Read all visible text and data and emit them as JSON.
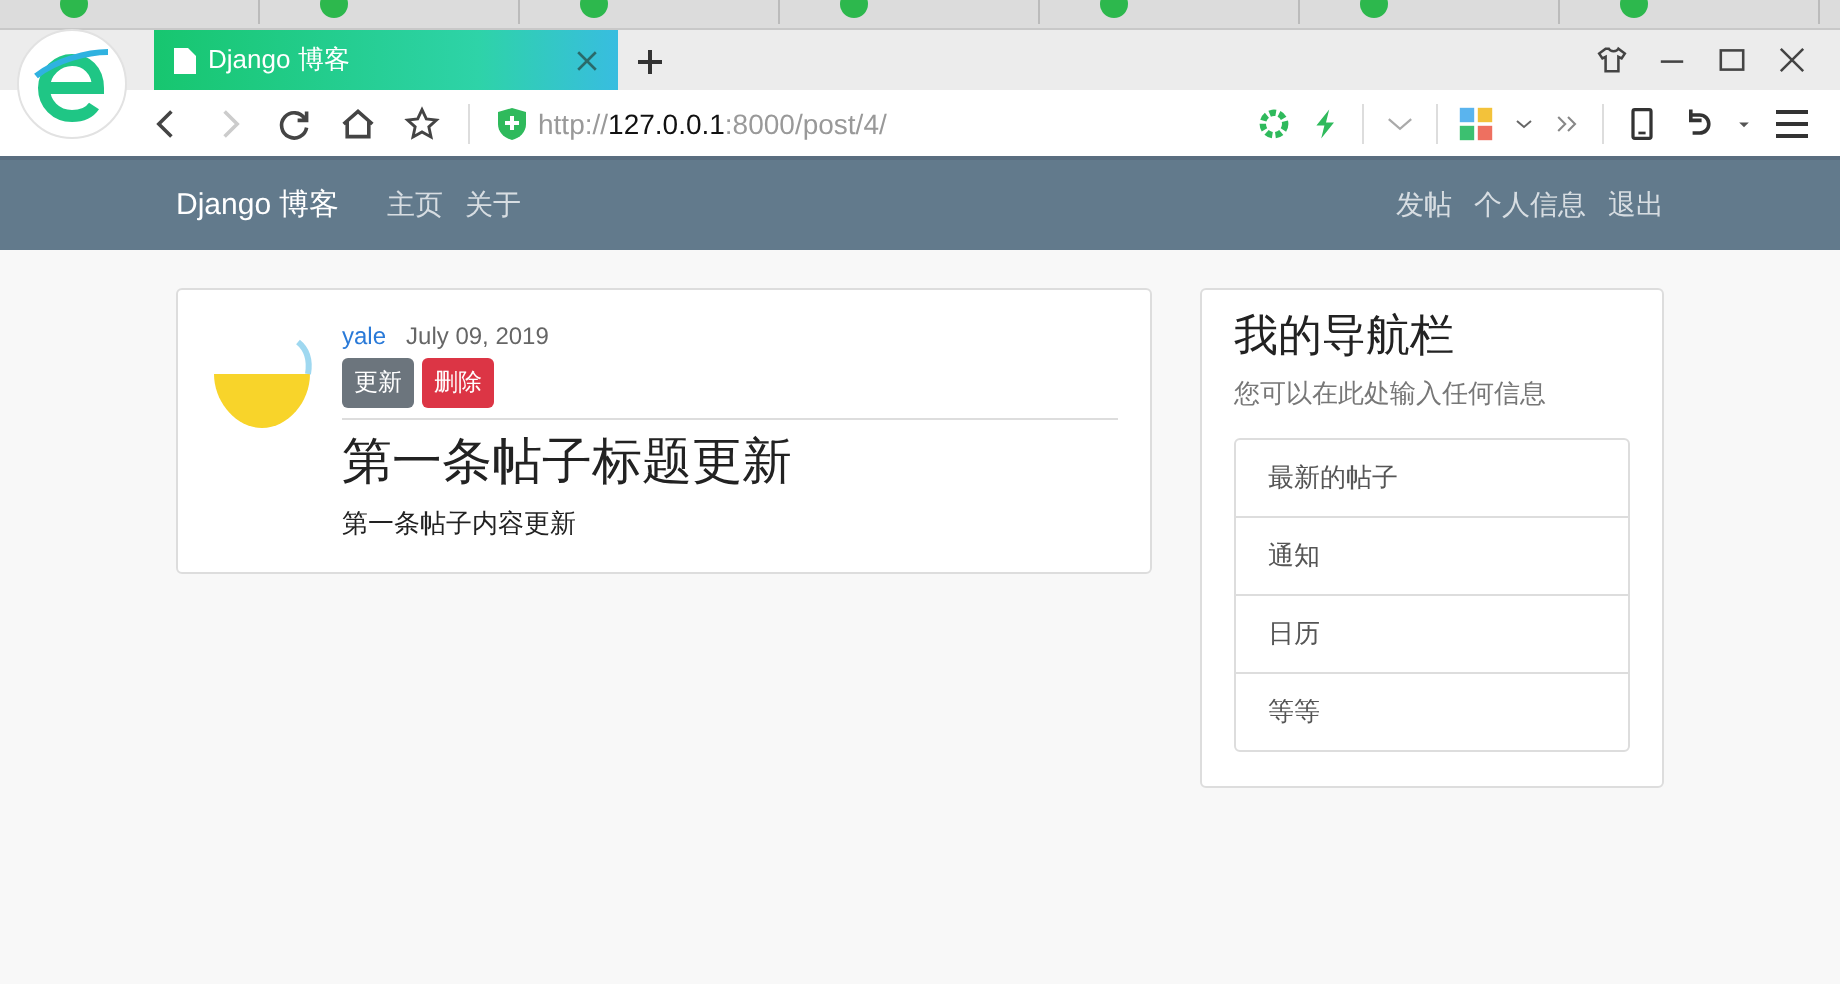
{
  "browser": {
    "active_tab": {
      "title": "Django 博客"
    },
    "address": {
      "scheme": "http://",
      "host": "127.0.0.1",
      "path": ":8000/post/4/"
    }
  },
  "navbar": {
    "brand": "Django 博客",
    "left_links": [
      "主页",
      "关于"
    ],
    "right_links": [
      "发帖",
      "个人信息",
      "退出"
    ]
  },
  "post": {
    "author": "yale",
    "date": "July 09, 2019",
    "buttons": [
      {
        "label": "更新",
        "kind": "secondary"
      },
      {
        "label": "删除",
        "kind": "danger"
      }
    ],
    "title": "第一条帖子标题更新",
    "content": "第一条帖子内容更新"
  },
  "sidebar": {
    "title": "我的导航栏",
    "subtitle": "您可以在此处输入任何信息",
    "items": [
      "最新的帖子",
      "通知",
      "日历",
      "等等"
    ]
  }
}
